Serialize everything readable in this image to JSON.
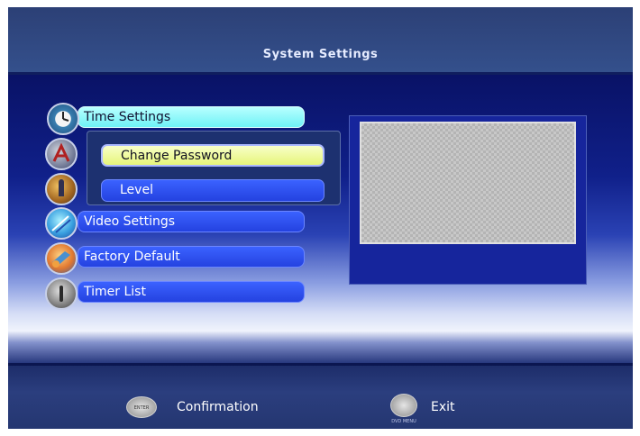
{
  "title": "System Settings",
  "menu": {
    "items": [
      {
        "label": "Time Settings",
        "icon": "clock-icon",
        "state": "selected"
      },
      {
        "label": "",
        "icon": "password-icon",
        "state": "normal"
      },
      {
        "label": "",
        "icon": "level-icon",
        "state": "normal"
      },
      {
        "label": "Video Settings",
        "icon": "video-icon",
        "state": "normal"
      },
      {
        "label": "Factory Default",
        "icon": "factory-default-icon",
        "state": "normal"
      },
      {
        "label": "Timer List",
        "icon": "timer-icon",
        "state": "normal"
      }
    ]
  },
  "submenu": {
    "items": [
      {
        "label": "Change Password",
        "state": "selected"
      },
      {
        "label": "Level",
        "state": "normal"
      }
    ]
  },
  "footer": {
    "confirm": {
      "label": "Confirmation",
      "button_text": "ENTER"
    },
    "exit": {
      "label": "Exit",
      "button_text": "DVD MENU"
    }
  },
  "colors": {
    "highlight": "#80f4f8",
    "sub_highlight": "#eaf58a",
    "menu_blue": "#2f50f0",
    "header": "#2e4580"
  }
}
